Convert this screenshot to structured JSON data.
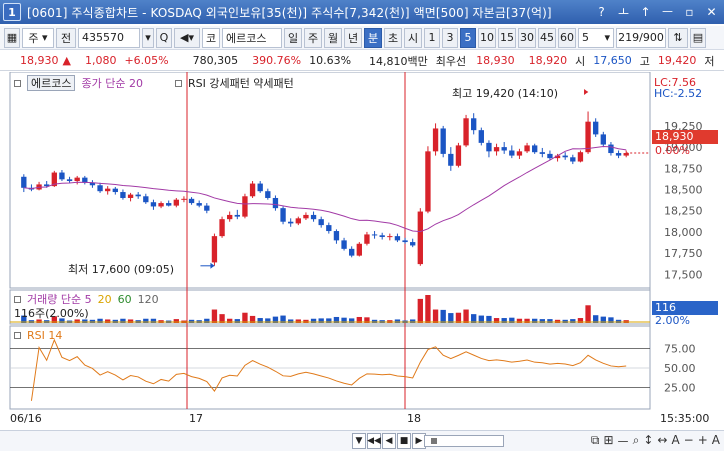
{
  "window": {
    "number": "1",
    "title": "[0601] 주식종합차트 - KOSDAQ 외국인보유[35(천)] 주식수[7,342(천)] 액면[500] 자본금[37(억)]",
    "buttons": [
      "?",
      "ㅗ",
      "↑",
      "ㅡ",
      "▫",
      "✕"
    ]
  },
  "toolbar": {
    "market_select": "주",
    "prev_label": "전",
    "code": "435570",
    "code_search": "Q",
    "stock_prefix": "코",
    "stock_name": "에르코스",
    "periods": [
      "일",
      "주",
      "월",
      "년",
      "분",
      "초",
      "시"
    ],
    "period_selected": "분",
    "intervals": [
      "1",
      "3",
      "5",
      "10",
      "15",
      "30",
      "45",
      "60"
    ],
    "interval_selected": "5",
    "custom_interval": "5",
    "position": "219/900"
  },
  "quote": {
    "price": "18,930",
    "arrow": "▲",
    "change": "1,080",
    "change_pct": "+6.05%",
    "volume": "780,305",
    "volume_ratio": "390.76%",
    "turnover": "10.63%",
    "amount": "14,810백만",
    "best_ask_label": "최우선",
    "best_ask": "18,930",
    "best_bid": "18,920",
    "low_label": "시",
    "low_value": "17,650",
    "high_label": "고",
    "high_value": "19,420",
    "limit_label": "저"
  },
  "price_panel": {
    "stock_label": "에르코스",
    "ma_label": "종가 단순 20",
    "pattern_label": "RSI 강세패턴 약세패턴",
    "high_annotation": "최고 19,420 (14:10)",
    "low_annotation": "최저 17,600 (09:05)",
    "lc": "LC:7.56",
    "hc": "HC:-2.52",
    "current_price": "18,930",
    "current_pct": "0.00%"
  },
  "volume_panel": {
    "label": "거래량 단순 5",
    "ma1": "20",
    "ma2": "60",
    "ma3": "120",
    "sub_label": "116주(2.00%)",
    "box_value": "116",
    "box_pct": "2.00%"
  },
  "rsi_panel": {
    "label": "RSI 14"
  },
  "time_axis": {
    "labels": [
      "06/16",
      "17",
      "18"
    ],
    "right_time": "15:35:00"
  },
  "chart_data": {
    "type": "candlestick",
    "price_axis_ticks": [
      19250,
      19000,
      18750,
      18500,
      18250,
      18000,
      17750,
      17500
    ],
    "price_ylim": [
      17350,
      19650
    ],
    "rsi_axis_ticks": [
      75,
      50,
      25
    ],
    "rsi_ylim": [
      0,
      100
    ],
    "day_separators": [
      "17",
      "18"
    ],
    "series": [
      {
        "name": "종가 단순 20",
        "color": "#a23aa6"
      },
      {
        "name": "RSI 14",
        "color": "#e07a1a"
      }
    ],
    "candles": [
      [
        18650,
        18680,
        18470,
        18520
      ],
      [
        18520,
        18560,
        18480,
        18500
      ],
      [
        18500,
        18590,
        18490,
        18560
      ],
      [
        18560,
        18600,
        18520,
        18540
      ],
      [
        18540,
        18720,
        18530,
        18700
      ],
      [
        18700,
        18730,
        18600,
        18620
      ],
      [
        18620,
        18650,
        18580,
        18600
      ],
      [
        18600,
        18660,
        18560,
        18640
      ],
      [
        18640,
        18660,
        18560,
        18580
      ],
      [
        18580,
        18610,
        18520,
        18550
      ],
      [
        18550,
        18580,
        18460,
        18480
      ],
      [
        18480,
        18540,
        18440,
        18510
      ],
      [
        18510,
        18530,
        18440,
        18470
      ],
      [
        18470,
        18500,
        18380,
        18400
      ],
      [
        18400,
        18460,
        18360,
        18440
      ],
      [
        18440,
        18470,
        18390,
        18420
      ],
      [
        18420,
        18450,
        18330,
        18350
      ],
      [
        18350,
        18380,
        18260,
        18300
      ],
      [
        18300,
        18360,
        18280,
        18340
      ],
      [
        18340,
        18370,
        18300,
        18310
      ],
      [
        18310,
        18400,
        18290,
        18380
      ],
      [
        18380,
        18420,
        18350,
        18390
      ],
      [
        18390,
        18410,
        18320,
        18340
      ],
      [
        18340,
        18370,
        18290,
        18310
      ],
      [
        18310,
        18340,
        18220,
        18250
      ],
      [
        17640,
        17980,
        17600,
        17950
      ],
      [
        17950,
        18180,
        17930,
        18150
      ],
      [
        18150,
        18240,
        18120,
        18200
      ],
      [
        18200,
        18260,
        18150,
        18180
      ],
      [
        18180,
        18450,
        18160,
        18420
      ],
      [
        18420,
        18600,
        18400,
        18570
      ],
      [
        18570,
        18600,
        18460,
        18480
      ],
      [
        18480,
        18510,
        18380,
        18400
      ],
      [
        18400,
        18430,
        18250,
        18280
      ],
      [
        18280,
        18300,
        18090,
        18120
      ],
      [
        18120,
        18160,
        18060,
        18100
      ],
      [
        18100,
        18180,
        18080,
        18160
      ],
      [
        18160,
        18230,
        18140,
        18200
      ],
      [
        18200,
        18240,
        18120,
        18150
      ],
      [
        18150,
        18180,
        18050,
        18080
      ],
      [
        18080,
        18110,
        17980,
        18010
      ],
      [
        18010,
        18030,
        17860,
        17900
      ],
      [
        17900,
        17930,
        17780,
        17800
      ],
      [
        17800,
        17830,
        17700,
        17720
      ],
      [
        17720,
        17880,
        17710,
        17860
      ],
      [
        17860,
        18000,
        17840,
        17970
      ],
      [
        17970,
        18010,
        17920,
        17960
      ],
      [
        17960,
        17990,
        17910,
        17940
      ],
      [
        17940,
        17980,
        17900,
        17950
      ],
      [
        17950,
        17980,
        17880,
        17900
      ],
      [
        17900,
        17930,
        17860,
        17880
      ],
      [
        17880,
        17920,
        17820,
        17840
      ],
      [
        17620,
        18280,
        17600,
        18240
      ],
      [
        18240,
        19010,
        18220,
        18950
      ],
      [
        18950,
        19280,
        18900,
        19220
      ],
      [
        19220,
        19250,
        18880,
        18920
      ],
      [
        18920,
        19000,
        18720,
        18780
      ],
      [
        18780,
        19050,
        18760,
        19020
      ],
      [
        19020,
        19380,
        19000,
        19340
      ],
      [
        19340,
        19400,
        19150,
        19200
      ],
      [
        19200,
        19230,
        19020,
        19050
      ],
      [
        19050,
        19080,
        18880,
        18950
      ],
      [
        18950,
        19040,
        18900,
        19000
      ],
      [
        19000,
        19060,
        18920,
        18960
      ],
      [
        18960,
        19020,
        18870,
        18900
      ],
      [
        18900,
        18980,
        18860,
        18950
      ],
      [
        18950,
        19050,
        18930,
        19020
      ],
      [
        19020,
        19040,
        18920,
        18940
      ],
      [
        18940,
        18990,
        18880,
        18920
      ],
      [
        18920,
        18960,
        18850,
        18870
      ],
      [
        18870,
        18920,
        18830,
        18900
      ],
      [
        18900,
        18940,
        18850,
        18880
      ],
      [
        18880,
        18910,
        18800,
        18830
      ],
      [
        18830,
        18960,
        18820,
        18940
      ],
      [
        18940,
        19420,
        18920,
        19300
      ],
      [
        19300,
        19340,
        19120,
        19150
      ],
      [
        19150,
        19180,
        19000,
        19030
      ],
      [
        19030,
        19060,
        18900,
        18930
      ],
      [
        18930,
        18960,
        18870,
        18900
      ],
      [
        18900,
        18960,
        18880,
        18930
      ]
    ]
  }
}
